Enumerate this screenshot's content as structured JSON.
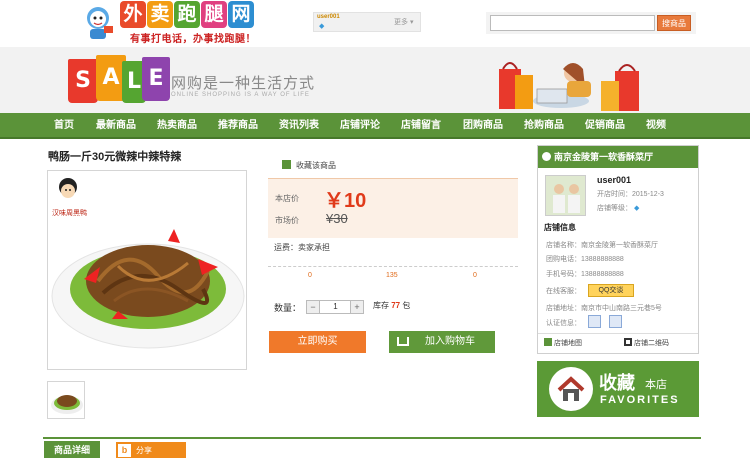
{
  "logo": {
    "chars": [
      "外",
      "卖",
      "跑",
      "腿",
      "网"
    ],
    "char_colors": [
      "#e94b2b",
      "#f39c12",
      "#55a531",
      "#e04080",
      "#2d8ed1"
    ],
    "slogan": "有事打电话，办事找跑腿！"
  },
  "userbox": {
    "username": "user001",
    "more": "更多"
  },
  "search": {
    "placeholder": "",
    "button": "搜商品"
  },
  "banner": {
    "sale_letters": [
      "S",
      "A",
      "L",
      "E"
    ],
    "slogan": "网购是一种生活方式",
    "sub": "ONLINE SHOPPING IS A WAY OF LIFE"
  },
  "nav": [
    "首页",
    "最新商品",
    "热卖商品",
    "推荐商品",
    "资讯列表",
    "店铺评论",
    "店铺留言",
    "团购商品",
    "抢购商品",
    "促销商品",
    "视频"
  ],
  "product": {
    "title": "鸭肠一斤30元微辣中辣特辣",
    "image_label": "汉味周黑鸭",
    "favorite": "收藏该商品",
    "price_label": "本店价",
    "price": "￥10",
    "market_label": "市场价",
    "market_price": "¥30",
    "shipping": "运费：卖家承担",
    "stats": [
      "0",
      "135",
      "0"
    ],
    "qty_label": "数量：",
    "qty": "1",
    "stock_prefix": "库存",
    "stock": "77",
    "stock_unit": "包",
    "buy_now": "立即购买",
    "add_cart": "加入购物车"
  },
  "shop": {
    "name": "南京金陵第一软香酥菜厅",
    "user": "user001",
    "open_label": "开店时间：",
    "open_date": "2015-12-3",
    "level_label": "店铺等级：",
    "info_title": "店铺信息",
    "rows": [
      {
        "label": "店铺名称：",
        "value": "南京金陵第一软香酥菜厅"
      },
      {
        "label": "团购电话：",
        "value": "13888888888"
      },
      {
        "label": "手机号码：",
        "value": "13888888888"
      },
      {
        "label": "在线客服：",
        "value": ""
      },
      {
        "label": "店铺地址：",
        "value": "南京市中山南路三元巷5号"
      },
      {
        "label": "认证信息：",
        "value": ""
      }
    ],
    "qq_label": "QQ交谈",
    "map": "店铺地图",
    "qrcode": "店铺二维码"
  },
  "fav_banner": {
    "cn": "收藏",
    "small": "本店",
    "en": "FAVORITES"
  },
  "tabs": {
    "detail": "商品详细",
    "share": "分享"
  }
}
